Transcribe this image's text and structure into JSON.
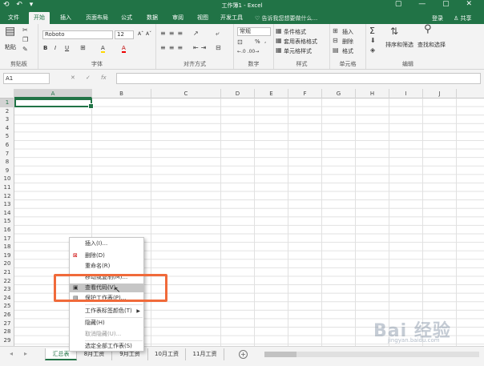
{
  "window": {
    "title": "工作簿1 - Excel",
    "qat": "⟲ ↶ ▾",
    "controls": "▢ — ▢ ✕"
  },
  "tabs": [
    "文件",
    "开始",
    "插入",
    "页面布局",
    "公式",
    "数据",
    "审阅",
    "视图",
    "开发工具"
  ],
  "tell_me": "♡ 告诉我您想要做什么...",
  "login": "登录",
  "share": "♙ 共享",
  "ribbon": {
    "clipboard": {
      "paste": "粘贴",
      "label": "剪贴板"
    },
    "font": {
      "name": "Roboto",
      "size": "12",
      "label": "字体",
      "b": "B",
      "i": "I",
      "u": "U",
      "grow": "Aˆ",
      "shrink": "Aˇ",
      "fill": "A",
      "color": "A"
    },
    "align": {
      "label": "对齐方式"
    },
    "number": {
      "format": "常规",
      "percent": "%",
      "comma": ",",
      "label": "数字"
    },
    "styles": {
      "cond": "条件格式",
      "table": "套用表格格式",
      "cell": "单元格样式",
      "label": "样式"
    },
    "cells": {
      "insert": "插入",
      "delete": "删除",
      "format": "格式",
      "label": "单元格"
    },
    "editing": {
      "sigma": "Σ",
      "sort": "排序和筛选",
      "find": "查找和选择",
      "label": "编辑"
    }
  },
  "formula": {
    "cell": "A1",
    "cancel": "✕",
    "enter": "✓",
    "fx": "fx"
  },
  "columns": [
    "A",
    "B",
    "C",
    "D",
    "E",
    "F",
    "G",
    "H",
    "I",
    "J"
  ],
  "rows": [
    "1",
    "2",
    "3",
    "4",
    "5",
    "6",
    "7",
    "8",
    "9",
    "10",
    "11",
    "12",
    "13",
    "14",
    "15",
    "16",
    "17",
    "18",
    "19",
    "20",
    "21",
    "22",
    "23",
    "24",
    "25",
    "26",
    "27",
    "28",
    "29"
  ],
  "sheets": [
    "汇总表",
    "8月工资",
    "9月工资",
    "10月工资",
    "11月工资"
  ],
  "add_sheet": "+",
  "context_menu": [
    {
      "label": "插入(I)...",
      "icon": ""
    },
    {
      "label": "删除(D)",
      "icon": "⊠"
    },
    {
      "label": "重命名(R)",
      "icon": ""
    },
    {
      "label": "移动或复制(M)...",
      "icon": ""
    },
    {
      "label": "查看代码(V)",
      "icon": "▣"
    },
    {
      "label": "保护工作表(P)...",
      "icon": "▤"
    },
    {
      "label": "工作表标签颜色(T)",
      "icon": ""
    },
    {
      "label": "隐藏(H)",
      "icon": ""
    },
    {
      "label": "取消隐藏(U)...",
      "icon": ""
    },
    {
      "label": "选定全部工作表(S)",
      "icon": ""
    }
  ],
  "watermark": "Bai 经验",
  "watermark_sub": "jingyan.baidu.com"
}
